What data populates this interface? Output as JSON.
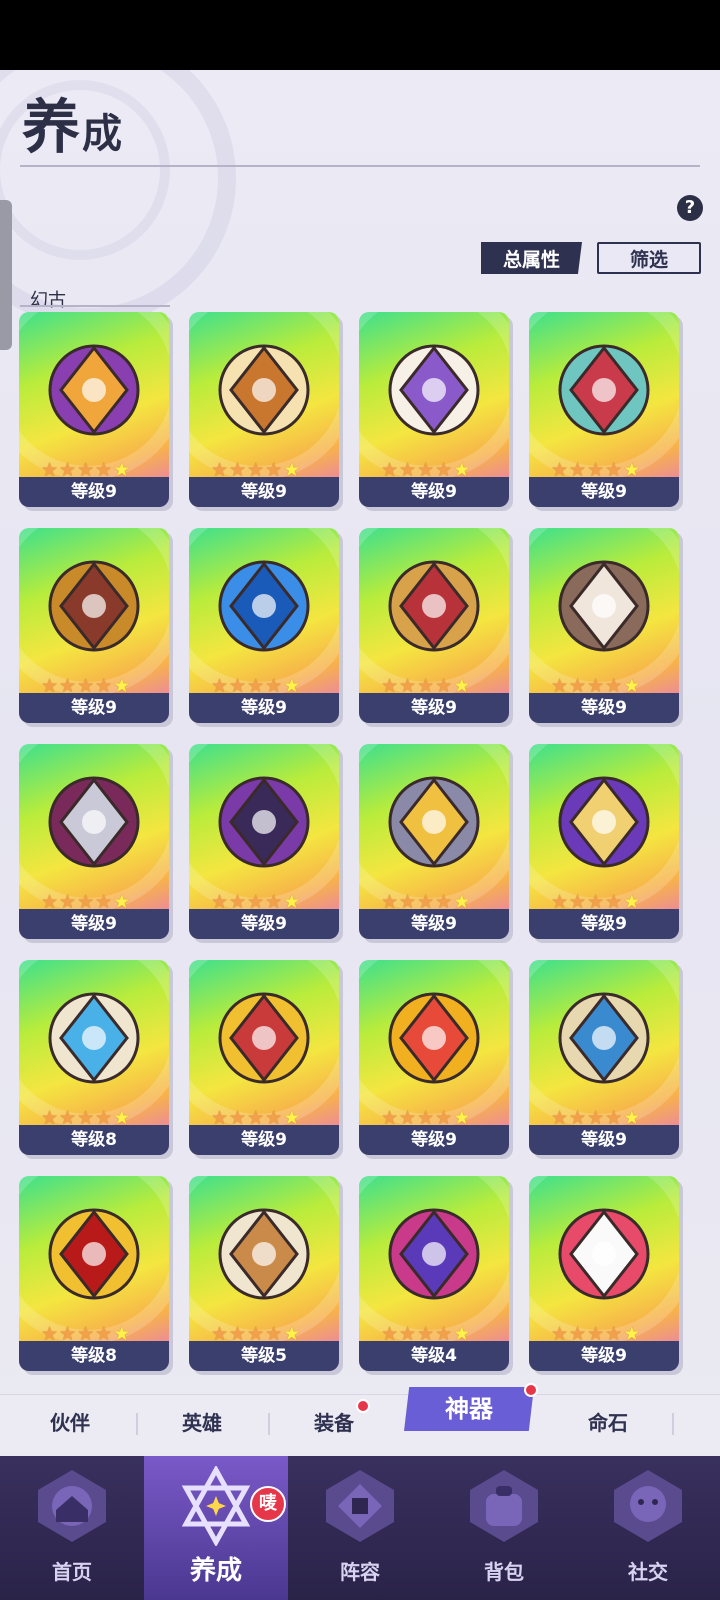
{
  "page": {
    "title_big": "养",
    "title_small": "成",
    "help_icon": "question-circle-icon",
    "buttons": {
      "total_attributes": "总属性",
      "filter": "筛选"
    },
    "section_label": "幻古"
  },
  "artifacts": [
    {
      "icon": "purple-skull-staff-icon",
      "stars": 5,
      "level": "等级9"
    },
    {
      "icon": "winged-shield-icon",
      "stars": 5,
      "level": "等级9"
    },
    {
      "icon": "castle-icon",
      "stars": 5,
      "level": "等级9"
    },
    {
      "icon": "sword-in-stone-icon",
      "stars": 5,
      "level": "等级9"
    },
    {
      "icon": "mimic-treasure-chest-icon",
      "stars": 5,
      "level": "等级9"
    },
    {
      "icon": "blue-hexagon-ring-icon",
      "stars": 5,
      "level": "等级9"
    },
    {
      "icon": "spiked-chain-ring-icon",
      "stars": 5,
      "level": "等级9"
    },
    {
      "icon": "eagle-icon",
      "stars": 5,
      "level": "等级9"
    },
    {
      "icon": "curved-dagger-icon",
      "stars": 5,
      "level": "等级9"
    },
    {
      "icon": "purple-locked-book-icon",
      "stars": 5,
      "level": "等级9"
    },
    {
      "icon": "skull-throne-icon",
      "stars": 5,
      "level": "等级9"
    },
    {
      "icon": "spell-book-icon",
      "stars": 5,
      "level": "等级9"
    },
    {
      "icon": "winged-balance-scales-icon",
      "stars": 5,
      "level": "等级8"
    },
    {
      "icon": "winged-golden-axe-icon",
      "stars": 5,
      "level": "等级9"
    },
    {
      "icon": "winged-golden-spear-icon",
      "stars": 5,
      "level": "等级9"
    },
    {
      "icon": "winged-scroll-icon",
      "stars": 5,
      "level": "等级9"
    },
    {
      "icon": "golden-goblet-icon",
      "stars": 5,
      "level": "等级8"
    },
    {
      "icon": "hooded-cloak-icon",
      "stars": 5,
      "level": "等级5"
    },
    {
      "icon": "jester-hat-icon",
      "stars": 5,
      "level": "等级4"
    },
    {
      "icon": "red-typewriter-icon",
      "stars": 5,
      "level": "等级9"
    }
  ],
  "sub_tabs": [
    {
      "label": "伙伴",
      "active": false,
      "dot": false
    },
    {
      "label": "英雄",
      "active": false,
      "dot": false
    },
    {
      "label": "装备",
      "active": false,
      "dot": true
    },
    {
      "label": "神器",
      "active": true,
      "dot": true
    },
    {
      "label": "命石",
      "active": false,
      "dot": false
    }
  ],
  "nav": [
    {
      "label": "首页",
      "icon": "home-emblem-icon",
      "active": false
    },
    {
      "label": "养成",
      "icon": "hexagram-star-icon",
      "active": true,
      "badge": "唛"
    },
    {
      "label": "阵容",
      "icon": "lineup-emblem-icon",
      "active": false
    },
    {
      "label": "背包",
      "icon": "backpack-emblem-icon",
      "active": false
    },
    {
      "label": "社交",
      "icon": "social-emblem-icon",
      "active": false
    }
  ],
  "colors": {
    "accent": "#6a5ed6",
    "nav_bg": "#2a2348",
    "level_bar": "#3a3f6e",
    "badge": "#e6374a"
  }
}
